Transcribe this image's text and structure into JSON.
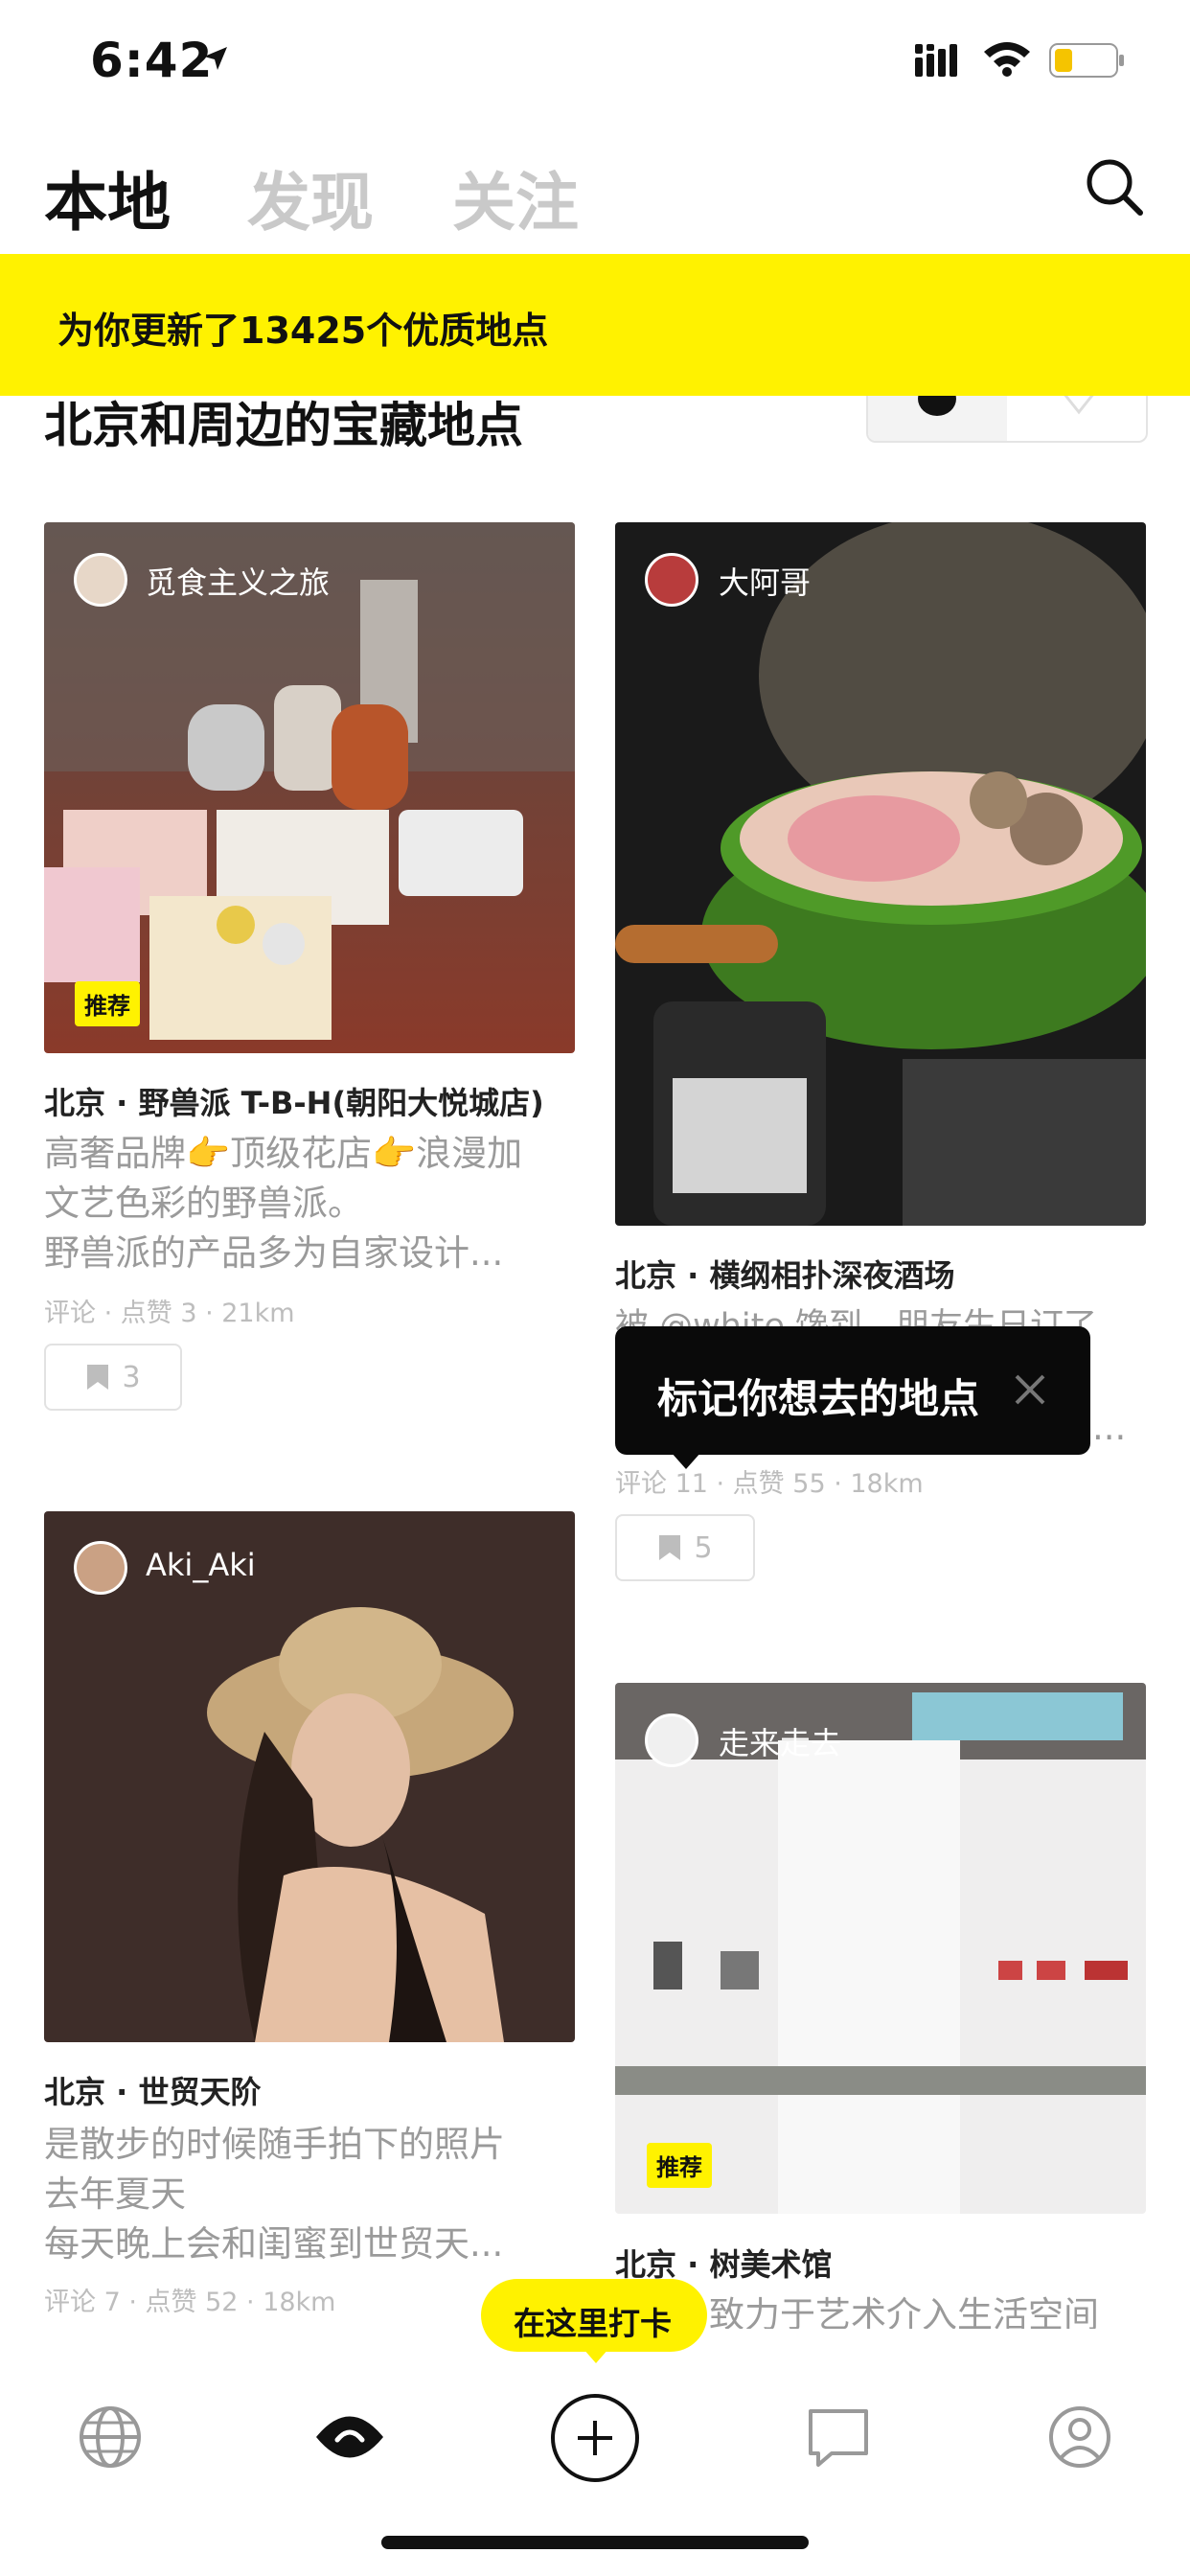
{
  "status_bar": {
    "time": "6:42"
  },
  "header": {
    "tabs": [
      {
        "label": "本地",
        "active": true
      },
      {
        "label": "发现",
        "active": false
      },
      {
        "label": "关注",
        "active": false
      }
    ]
  },
  "banner": {
    "text": "为你更新了13425个优质地点"
  },
  "section": {
    "title": "北京和周边的宝藏地点"
  },
  "cards": [
    {
      "author": "觅食主义之旅",
      "tag": "推荐",
      "title": "北京 · 野兽派 T-B-H(朝阳大悦城店)",
      "desc_lines": [
        "高奢品牌👉顶级花店👉浪漫加",
        "文艺色彩的野兽派。",
        "野兽派的产品多为自家设计..."
      ],
      "meta": "评论 · 点赞 3 · 21km",
      "saves": "3"
    },
    {
      "author": "大阿哥",
      "title": "北京 · 横纲相扑深夜酒场",
      "desc_lines": [
        "被 @white 馋到，朋友生日订了",
        "..."
      ],
      "meta": "评论 11 · 点赞 55 · 18km",
      "saves": "5"
    },
    {
      "author": "Aki_Aki",
      "title": "北京 · 世贸天阶",
      "desc_lines": [
        "是散步的时候随手拍下的照片",
        "去年夏天",
        "每天晚上会和闺蜜到世贸天..."
      ],
      "meta": "评论 7 · 点赞 52 · 18km"
    },
    {
      "author": "走来走去",
      "tag": "推荐",
      "title": "北京 · 树美术馆",
      "desc_lines": [
        "致力于艺术介入生活空间"
      ]
    }
  ],
  "tooltip": {
    "text": "标记你想去的地点"
  },
  "checkin_pill": {
    "text": "在这里打卡"
  },
  "bottom_nav": [
    "globe-icon",
    "eye-icon",
    "add-icon",
    "message-icon",
    "profile-icon"
  ],
  "colors": {
    "accent": "#fff200",
    "text": "#111111",
    "muted": "#9a9a9a"
  }
}
